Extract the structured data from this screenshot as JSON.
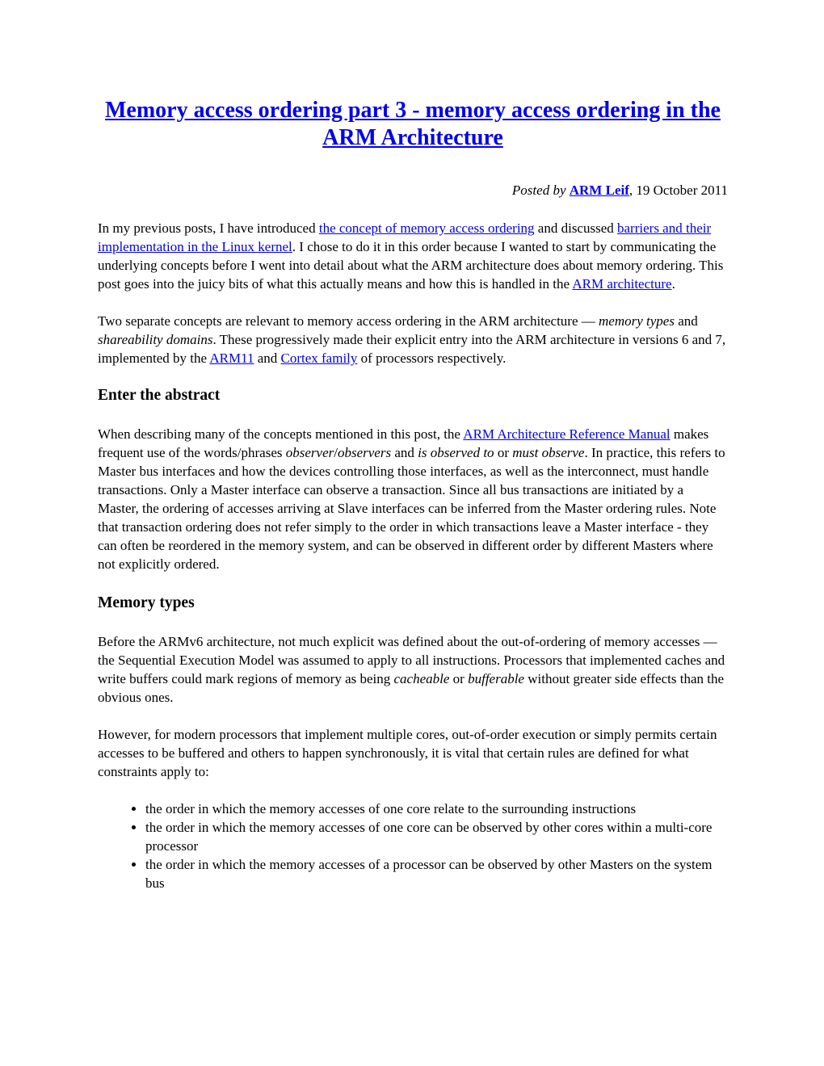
{
  "title": {
    "text": "Memory access ordering part 3 - memory access ordering in the ARM Architecture"
  },
  "byline": {
    "prefix": "Posted by",
    "author": "ARM Leif",
    "date": ", 19 October 2011"
  },
  "para1": {
    "t1": "In my previous posts, I have introduced ",
    "link1": "the concept of memory access ordering",
    "t2": " and discussed ",
    "link2": "barriers and their implementation in the Linux kernel",
    "t3": ". I chose to do it in this order because I wanted to start by communicating the underlying concepts before I went into detail about what the ARM architecture does about memory ordering. This post goes into the juicy bits of what this actually means and how this is handled in the ",
    "link3": "ARM architecture",
    "t4": "."
  },
  "para2": {
    "t1": "Two separate concepts are relevant to memory access ordering in the ARM architecture — ",
    "em1": "memory types",
    "t2": " and ",
    "em2": "shareability domains",
    "t3": ". These progressively made their explicit entry into the ARM architecture in versions 6 and 7, implemented by the ",
    "link1": "ARM11",
    "t4": " and ",
    "link2": "Cortex family",
    "t5": " of processors respectively."
  },
  "section_abstract": {
    "heading": "Enter the abstract",
    "t1": "When describing many of the concepts mentioned in this post, the ",
    "link1": "ARM Architecture Reference Manual",
    "t2": " makes frequent use of the words/phrases ",
    "em1": "observer",
    "t3": "/",
    "em2": "observers",
    "t4": " and ",
    "em3": "is observed to",
    "t5": " or ",
    "em4": "must observe",
    "t6": ". In practice, this refers to Master bus interfaces and how the devices controlling those interfaces, as well as the interconnect, must handle transactions. Only a Master interface can observe a transaction. Since all bus transactions are initiated by a Master, the ordering of accesses arriving at Slave interfaces can be inferred from the Master ordering rules. Note that transaction ordering does not refer simply to the order in which transactions leave a Master interface - they can often be reordered in the memory system, and can be observed in different order by different Masters where not explicitly ordered."
  },
  "section_memtypes": {
    "heading": "Memory types",
    "p1_t1": "Before the ARMv6 architecture, not much explicit was defined about the out-of-ordering of memory accesses — the Sequential Execution Model was assumed to apply to all instructions. Processors that implemented caches and write buffers could mark regions of memory as being ",
    "p1_em1": "cacheable",
    "p1_t2": " or ",
    "p1_em2": "bufferable",
    "p1_t3": " without greater side effects than the obvious ones.",
    "p2": "However, for modern processors that implement multiple cores, out-of-order execution or simply permits certain accesses to be buffered and others to happen synchronously, it is vital that certain rules are defined for what constraints apply to:",
    "bullets": [
      "the order in which the memory accesses of one core relate to the surrounding instructions",
      "the order in which the memory accesses of one core can be observed by other cores within a multi-core processor",
      "the order in which the memory accesses of a processor can be observed by other Masters on the system bus"
    ]
  }
}
